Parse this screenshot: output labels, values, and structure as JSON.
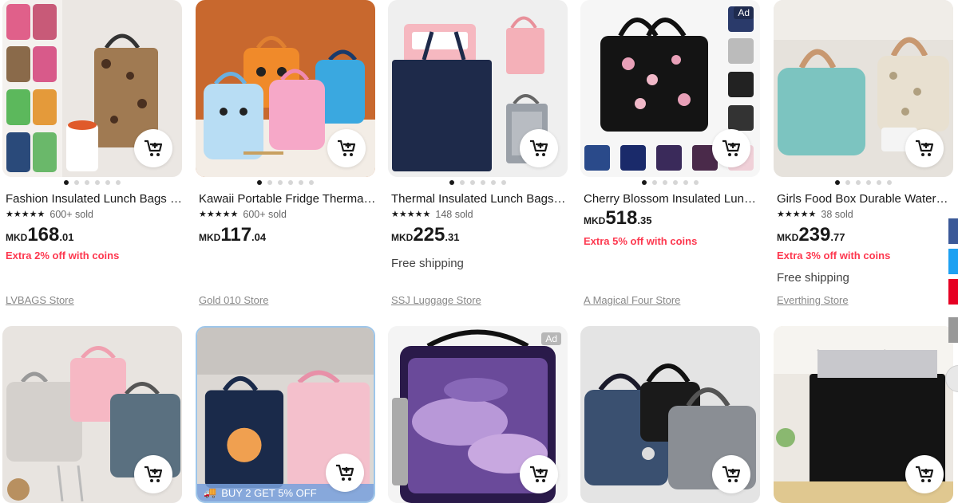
{
  "products": [
    {
      "title": "Fashion Insulated Lunch Bags For Women Waterproof",
      "sold": "600+ sold",
      "currency": "MKD",
      "price_int": "168",
      "price_dec": ".01",
      "coins": "Extra 2% off with coins",
      "shipping": "",
      "store": "LVBAGS Store",
      "ad": "",
      "dots": 6,
      "active_dot": 0
    },
    {
      "title": "Kawaii Portable Fridge Thermal Bag Kids",
      "sold": "600+ sold",
      "currency": "MKD",
      "price_int": "117",
      "price_dec": ".04",
      "coins": "",
      "shipping": "",
      "store": "Gold 010 Store",
      "ad": "",
      "dots": 6,
      "active_dot": 0
    },
    {
      "title": "Thermal Insulated Lunch Bags for Women",
      "sold": "148 sold",
      "currency": "MKD",
      "price_int": "225",
      "price_dec": ".31",
      "coins": "",
      "shipping": "Free shipping",
      "store": "SSJ Luggage Store",
      "ad": "",
      "dots": 6,
      "active_dot": 0
    },
    {
      "title": "Cherry Blossom Insulated Lunch Bag",
      "sold": "",
      "currency": "MKD",
      "price_int": "518",
      "price_dec": ".35",
      "coins": "Extra 5% off with coins",
      "shipping": "",
      "store": "A Magical Four Store",
      "ad": "Ad",
      "dots": 6,
      "active_dot": 0
    },
    {
      "title": "Girls Food Box Durable Waterproof",
      "sold": "38 sold",
      "currency": "MKD",
      "price_int": "239",
      "price_dec": ".77",
      "coins": "Extra 3% off with coins",
      "shipping": "Free shipping",
      "store": "Everthing Store",
      "ad": "",
      "dots": 6,
      "active_dot": 0
    }
  ],
  "row2": [
    {
      "ad": "",
      "promo": ""
    },
    {
      "ad": "",
      "promo": "BUY 2 GET 5% OFF"
    },
    {
      "ad": "Ad",
      "promo": ""
    },
    {
      "ad": "",
      "promo": ""
    },
    {
      "ad": "",
      "promo": ""
    }
  ],
  "social_colors": [
    "#3b5998",
    "#1da1f2",
    "#e60023",
    "#999999"
  ],
  "accent": "#fd384f",
  "icons": {
    "cart": "add-to-cart-icon",
    "star": "star-icon"
  }
}
